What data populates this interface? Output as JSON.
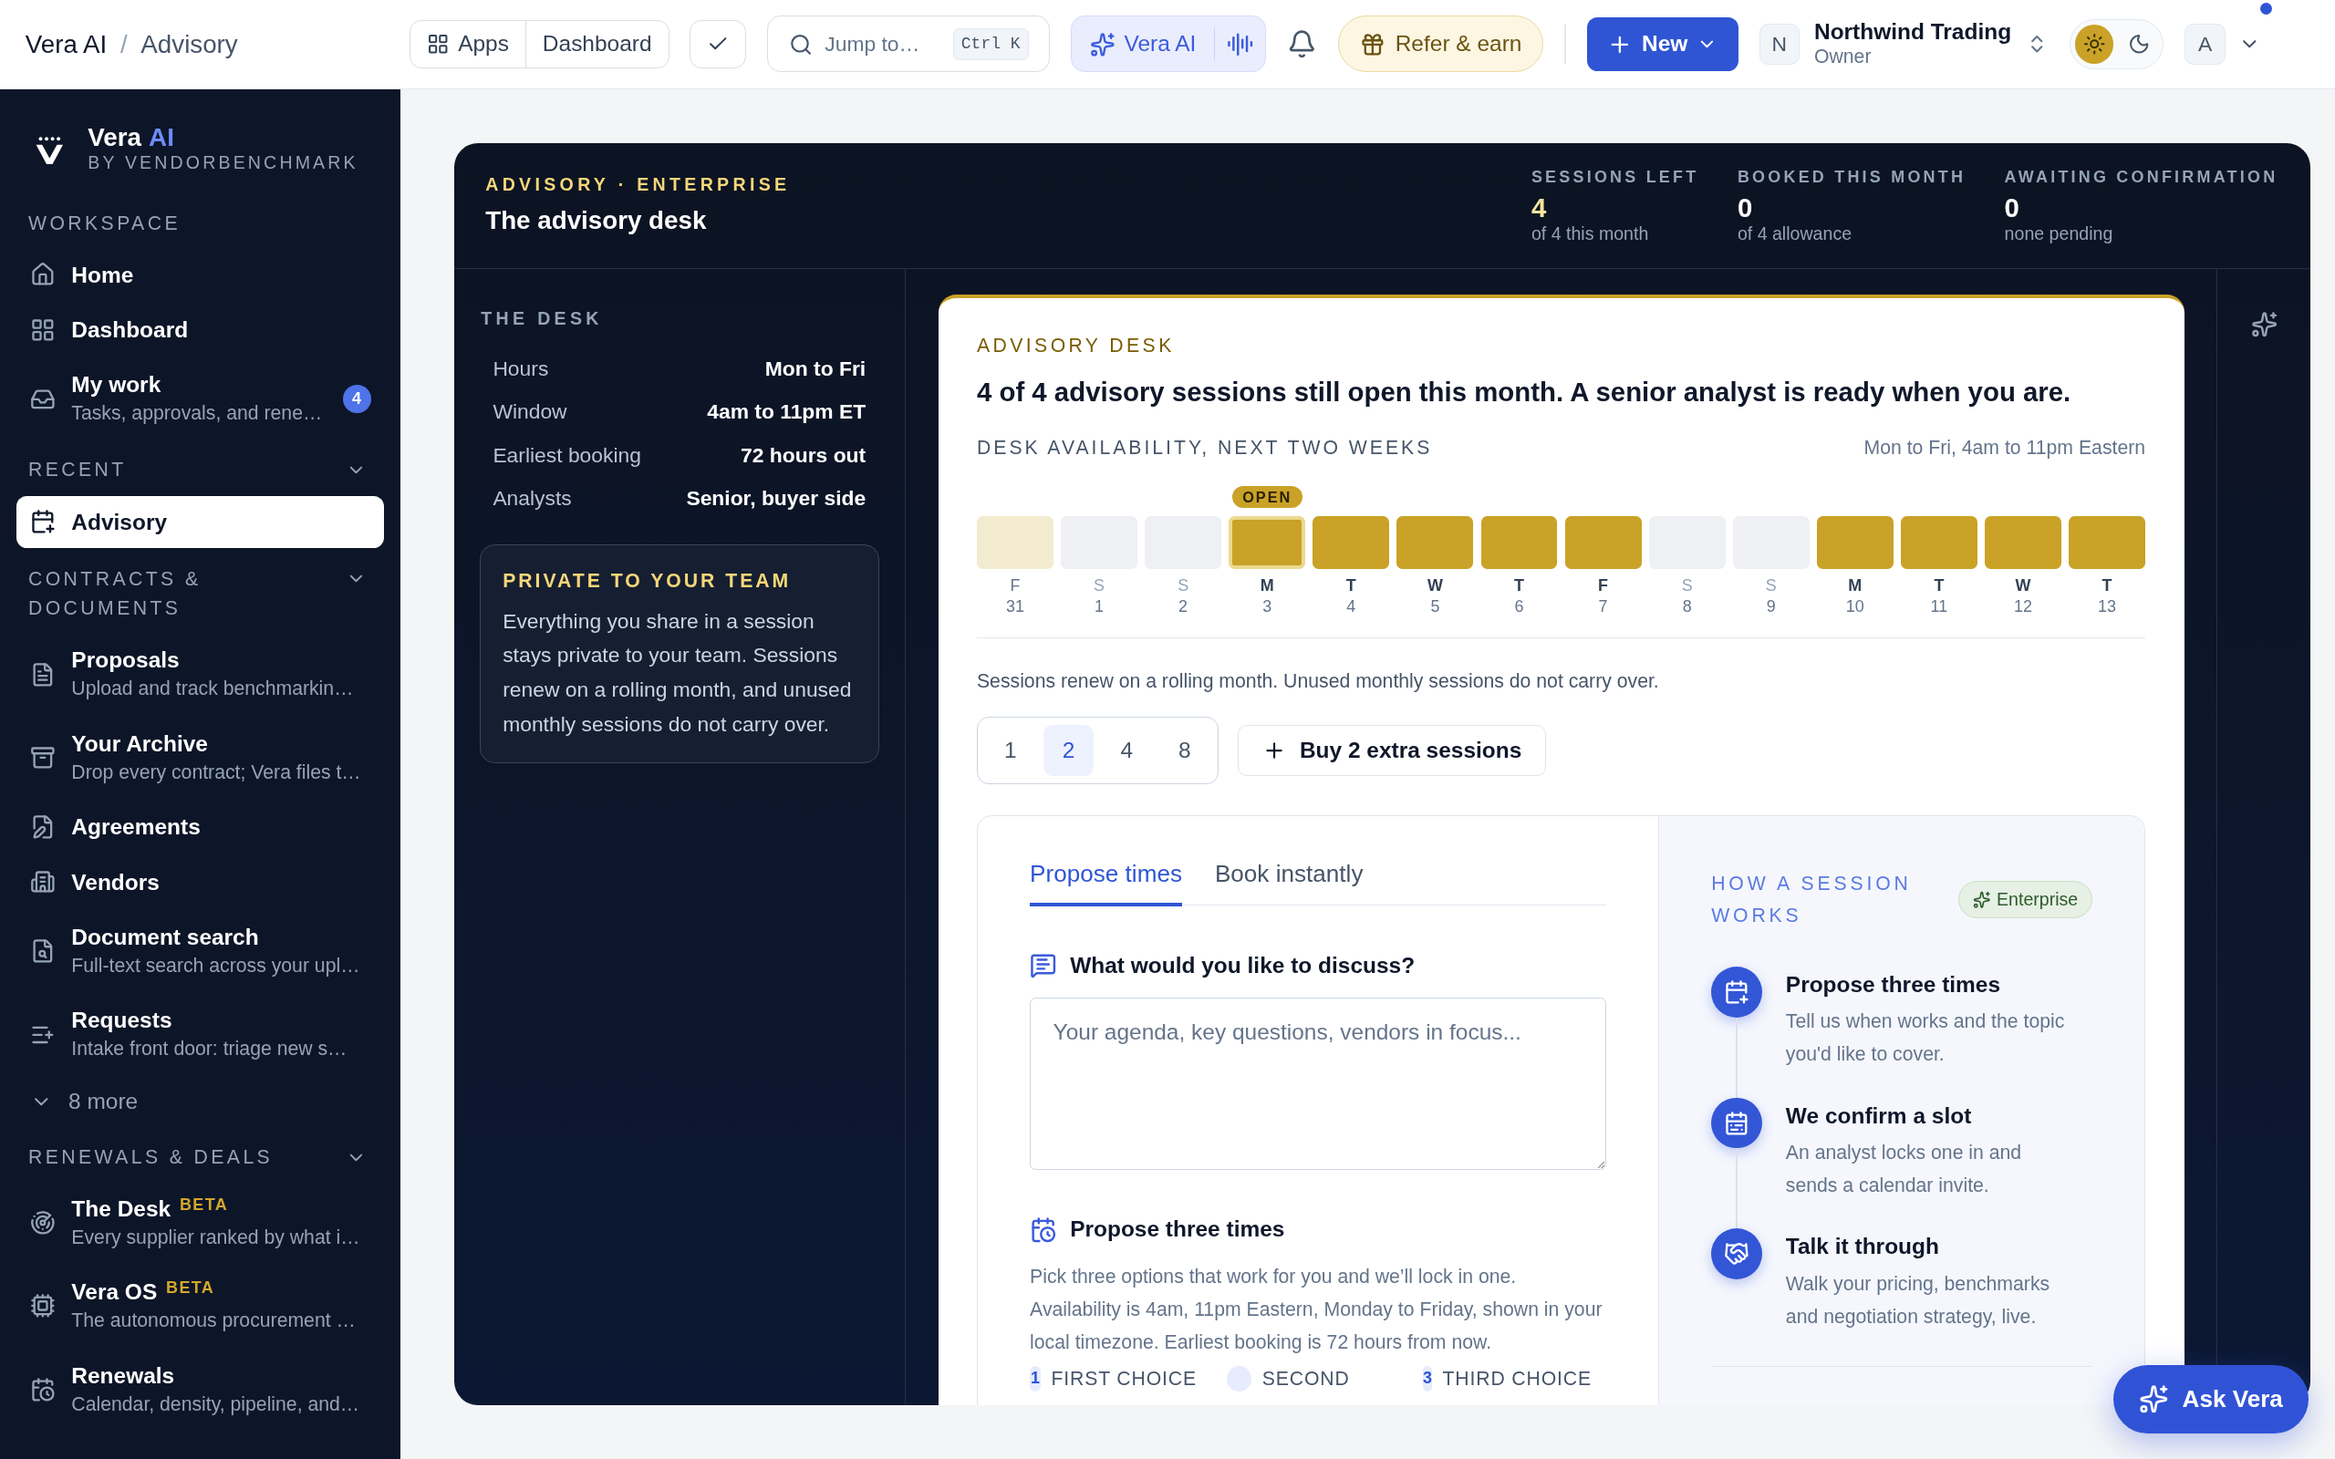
{
  "topbar": {
    "breadcrumb": [
      "Vera AI",
      "Advisory"
    ],
    "breadcrumb_separator": "/",
    "apps_label": "Apps",
    "dashboard_label": "Dashboard",
    "search": {
      "placeholder": "Jump to…",
      "shortcut": "Ctrl K"
    },
    "vera_label": "Vera AI",
    "refer_label": "Refer & earn",
    "new_label": "New",
    "org": {
      "initial": "N",
      "name": "Northwind Trading",
      "role": "Owner"
    },
    "theme": [
      {
        "selected": true
      },
      {
        "selected": false
      }
    ],
    "user_initial": "A",
    "notification_dot": true
  },
  "sidebar": {
    "brand": {
      "name": "Vera",
      "accent": "AI",
      "byline": "BY VENDORBENCHMARK"
    },
    "sections": [
      {
        "title": "WORKSPACE",
        "items": [
          {
            "label": "Home",
            "selected": false
          },
          {
            "label": "Dashboard",
            "selected": false
          },
          {
            "label": "My work",
            "sub": "Tasks, approvals, and rene…",
            "badge": "4",
            "selected": false
          }
        ]
      },
      {
        "title": "RECENT",
        "collapsible": true,
        "items": [
          {
            "label": "Advisory",
            "selected": true
          }
        ]
      },
      {
        "title": "CONTRACTS & DOCUMENTS",
        "collapsible": true,
        "items": [
          {
            "label": "Proposals",
            "sub": "Upload and track benchmarkin…",
            "selected": false
          },
          {
            "label": "Your Archive",
            "sub": "Drop every contract; Vera files t…",
            "selected": false
          },
          {
            "label": "Agreements",
            "selected": false
          },
          {
            "label": "Vendors",
            "selected": false
          },
          {
            "label": "Document search",
            "sub": "Full-text search across your upl…",
            "selected": false
          },
          {
            "label": "Requests",
            "sub": "Intake front door: triage new s…",
            "selected": false
          }
        ],
        "more": "8 more"
      },
      {
        "title": "RENEWALS & DEALS",
        "collapsible": true,
        "items": [
          {
            "label": "The Desk",
            "tag": "BETA",
            "sub": "Every supplier ranked by what i…",
            "selected": false
          },
          {
            "label": "Vera OS",
            "tag": "BETA",
            "sub": "The autonomous procurement …",
            "selected": false
          },
          {
            "label": "Renewals",
            "sub": "Calendar, density, pipeline, and…",
            "selected": false
          }
        ]
      }
    ]
  },
  "desk_header": {
    "eyebrow": "ADVISORY · ENTERPRISE",
    "title": "The advisory desk",
    "stats": [
      {
        "label": "SESSIONS LEFT",
        "value": "4",
        "note": "of 4 this month",
        "highlight": true
      },
      {
        "label": "BOOKED THIS MONTH",
        "value": "0",
        "note": "of 4 allowance",
        "highlight": false
      },
      {
        "label": "AWAITING CONFIRMATION",
        "value": "0",
        "note": "none pending",
        "highlight": false
      }
    ]
  },
  "the_desk": {
    "title": "THE DESK",
    "rows": [
      {
        "label": "Hours",
        "value": "Mon to Fri"
      },
      {
        "label": "Window",
        "value": "4am to 11pm ET"
      },
      {
        "label": "Earliest booking",
        "value": "72 hours out"
      },
      {
        "label": "Analysts",
        "value": "Senior, buyer side"
      }
    ],
    "private": {
      "title": "PRIVATE TO YOUR TEAM",
      "text": "Everything you share in a session stays private to your team. Sessions renew on a rolling month, and unused monthly sessions do not carry over."
    }
  },
  "advisory": {
    "eyebrow": "ADVISORY DESK",
    "headline": "4 of 4 advisory sessions still open this month. A senior analyst is ready when you are.",
    "availability_title": "DESK AVAILABILITY, NEXT TWO WEEKS",
    "availability_note": "Mon to Fri, 4am to 11pm Eastern",
    "days": [
      {
        "dow": "F",
        "date": "31",
        "kind": "past",
        "selected": false
      },
      {
        "dow": "S",
        "date": "1",
        "kind": "weekend",
        "selected": false
      },
      {
        "dow": "S",
        "date": "2",
        "kind": "weekend",
        "selected": false
      },
      {
        "dow": "M",
        "date": "3",
        "kind": "open",
        "selected": true,
        "badge": "OPEN"
      },
      {
        "dow": "T",
        "date": "4",
        "kind": "open",
        "selected": false
      },
      {
        "dow": "W",
        "date": "5",
        "kind": "open",
        "selected": false
      },
      {
        "dow": "T",
        "date": "6",
        "kind": "open",
        "selected": false
      },
      {
        "dow": "F",
        "date": "7",
        "kind": "open",
        "selected": false
      },
      {
        "dow": "S",
        "date": "8",
        "kind": "weekend",
        "selected": false
      },
      {
        "dow": "S",
        "date": "9",
        "kind": "weekend",
        "selected": false
      },
      {
        "dow": "M",
        "date": "10",
        "kind": "open",
        "selected": false
      },
      {
        "dow": "T",
        "date": "11",
        "kind": "open",
        "selected": false
      },
      {
        "dow": "W",
        "date": "12",
        "kind": "open",
        "selected": false
      },
      {
        "dow": "T",
        "date": "13",
        "kind": "open",
        "selected": false
      }
    ],
    "renew_note": "Sessions renew on a rolling month. Unused monthly sessions do not carry over.",
    "quantities": [
      {
        "label": "1",
        "selected": false
      },
      {
        "label": "2",
        "selected": true
      },
      {
        "label": "4",
        "selected": false
      },
      {
        "label": "8",
        "selected": false
      }
    ],
    "buy_label": "Buy 2 extra sessions",
    "tabs": [
      {
        "label": "Propose times",
        "selected": true
      },
      {
        "label": "Book instantly",
        "selected": false
      }
    ],
    "discuss": {
      "label": "What would you like to discuss?",
      "placeholder": "Your agenda, key questions, vendors in focus..."
    },
    "propose": {
      "title": "Propose three times",
      "text": "Pick three options that work for you and we’ll lock in one. Availability is 4am, 11pm Eastern, Monday to Friday, shown in your local timezone. Earliest booking is 72 hours from now.",
      "choices": [
        {
          "number": "1",
          "label": "FIRST CHOICE"
        },
        {
          "label": "SECOND"
        },
        {
          "number": "3",
          "label": "THIRD CHOICE"
        }
      ]
    },
    "how": {
      "title": "HOW A SESSION WORKS",
      "badge": "Enterprise",
      "steps": [
        {
          "title": "Propose three times",
          "text": "Tell us when works and the topic you'd like to cover."
        },
        {
          "title": "We confirm a slot",
          "text": "An analyst locks one in and sends a calendar invite."
        },
        {
          "title": "Talk it through",
          "text": "Walk your pricing, benchmarks and negotiation strategy, live."
        }
      ]
    }
  },
  "ask_button": "Ask Vera"
}
